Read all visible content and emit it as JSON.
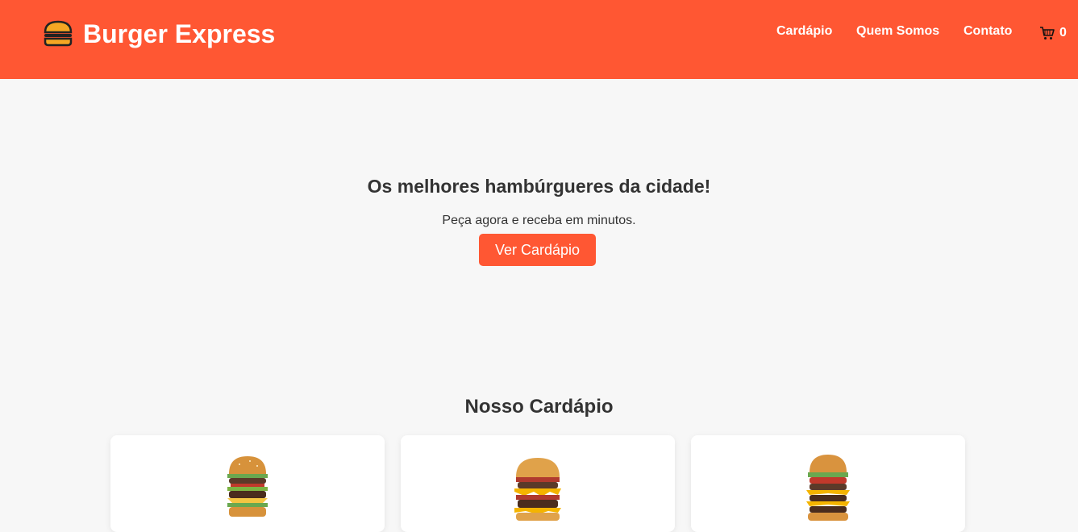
{
  "header": {
    "brand_title": "Burger Express",
    "nav": [
      {
        "label": "Cardápio"
      },
      {
        "label": "Quem Somos"
      },
      {
        "label": "Contato"
      }
    ],
    "cart_count": "0"
  },
  "hero": {
    "title": "Os melhores hambúrgueres da cidade!",
    "subtitle": "Peça agora e receba em minutos.",
    "button_label": "Ver Cardápio"
  },
  "menu": {
    "title": "Nosso Cardápio",
    "cards": [
      {
        "image_icon": "burger-classic-icon"
      },
      {
        "image_icon": "burger-bacon-cheese-icon"
      },
      {
        "image_icon": "burger-triple-icon"
      }
    ]
  },
  "colors": {
    "primary": "#ff5733",
    "background": "#f7f7f7",
    "text": "#333333"
  }
}
